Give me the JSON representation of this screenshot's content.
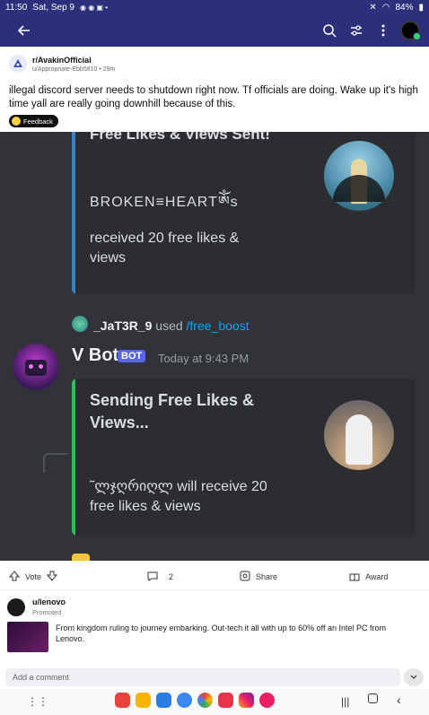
{
  "status": {
    "time": "11:50",
    "date": "Sat, Sep 9",
    "battery": "84%"
  },
  "toolbar": {
    "back_icon": "arrow-left-icon",
    "search_icon": "search-icon",
    "filter_icon": "sort-icon",
    "more_icon": "more-vertical-icon"
  },
  "post": {
    "subreddit": "r/AvakinOfficial",
    "author": "u/Appropriate-Ebb5810",
    "age": "29m",
    "title": "illegal discord server needs to shutdown right now. Tf officials are doing. Wake up it's high time yall are really going downhill because of this.",
    "flair": "Feedback"
  },
  "screenshot": {
    "embed1_title": "Free Likes & Views Sent!",
    "embed1_user": "BROKEN≡HEARTༀs",
    "embed1_body": "received 20 free likes & views",
    "reply_user": "_JaT3R_9",
    "reply_used": "used",
    "reply_command": "/free_boost",
    "bot_name": "V Bot",
    "bot_badge": "BOT",
    "bot_time": "Today at 9:43 PM",
    "embed2_title": "Sending Free Likes & Views...",
    "embed2_body": "˜ლჯღრიღლ will receive 20 free likes & views",
    "colors": {
      "embed1_bar": "#3b82c4",
      "embed2_bar": "#2fbf5a",
      "background": "#313338"
    }
  },
  "actions": {
    "vote": "Vote",
    "comments": "2",
    "share": "Share",
    "award": "Award"
  },
  "promo": {
    "advertiser": "u/lenovo",
    "label": "Promoted",
    "text": "From kingdom ruling to journey embarking. Out-tech it all with up to 60% off an Intel PC from Lenovo."
  },
  "comment": {
    "placeholder": "Add a comment"
  }
}
